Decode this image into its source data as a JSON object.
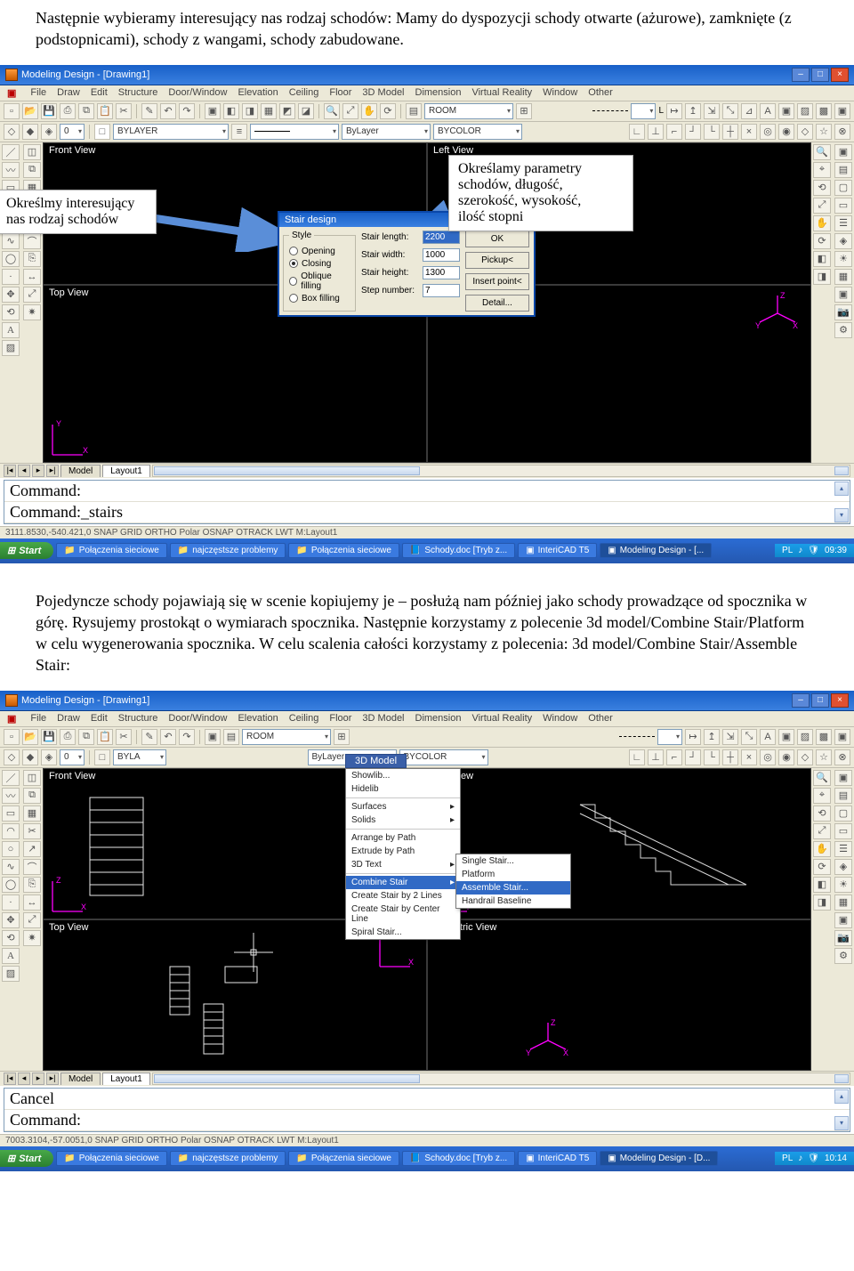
{
  "doc": {
    "intro": "Następnie wybieramy interesujący nas rodzaj schodów: Mamy do dyspozycji schody otwarte (ażurowe), zamknięte (z podstopnicami), schody z wangami, schody zabudowane.",
    "middle": "Pojedyncze schody pojawiają się w scenie kopiujemy je – posłużą nam później jako schody prowadzące od spocznika w górę. Rysujemy prostokąt o wymiarach spocznika. Następnie korzystamy z polecenie 3d model/Combine Stair/Platform w celu wygenerowania spocznika. W celu scalenia całości korzystamy z polecenia: 3d model/Combine Stair/Assemble Stair:"
  },
  "app": {
    "title": "Modeling Design - [Drawing1]",
    "menus": [
      "File",
      "Draw",
      "Edit",
      "Structure",
      "Door/Window",
      "Elevation",
      "Ceiling",
      "Floor",
      "3D Model",
      "Dimension",
      "Virtual Reality",
      "Window",
      "Other"
    ],
    "layer": "BYLAYER",
    "room": "ROOM",
    "bylayer2": "ByLayer",
    "bycolor": "BYCOLOR",
    "tabs": {
      "model": "Model",
      "layout": "Layout1"
    },
    "status1": "3111.8530,-540.421,0        SNAP  GRID  ORTHO  Polar  OSNAP  OTRACK  LWT  M:Layout1",
    "status2": "7003.3104,-57.0051,0        SNAP  GRID  ORTHO  Polar  OSNAP  OTRACK  LWT  M:Layout1",
    "cmd1a": "Command:",
    "cmd1b": "Command:_stairs",
    "cmd2a": "Cancel",
    "cmd2b": "Command:",
    "views": {
      "front": "Front View",
      "left": "Left View",
      "top": "Top View",
      "iso": "Isometric View"
    }
  },
  "callouts": {
    "left_lines": [
      "Określmy interesujący",
      "nas rodzaj schodów"
    ],
    "right_lines": [
      "Określamy parametry",
      "schodów, długość,",
      "szerokość, wysokość,",
      "ilość stopni"
    ]
  },
  "dialog": {
    "title": "Stair design",
    "style_label": "Style",
    "opening": "Opening",
    "closing": "Closing",
    "oblique": "Oblique filling",
    "box": "Box filling",
    "params": {
      "length_label": "Stair length:",
      "length": "2200",
      "width_label": "Stair width:",
      "width": "1000",
      "height_label": "Stair height:",
      "height": "1300",
      "step_label": "Step number:",
      "step": "7"
    },
    "buttons": {
      "ok": "OK",
      "pickup": "Pickup<",
      "insert": "Insert point<",
      "detail": "Detail..."
    }
  },
  "menu3d": {
    "label": "3D Model",
    "items": [
      "Showlib...",
      "Hidelib",
      "",
      "Surfaces",
      "Solids",
      "",
      "Arrange by Path",
      "Extrude by Path",
      "3D Text",
      "",
      "Combine Stair",
      "Create Stair by 2 Lines",
      "Create Stair by Center Line",
      "Spiral Stair..."
    ],
    "sub": [
      "Single Stair...",
      "Platform",
      "Assemble Stair...",
      "Handrail Baseline"
    ]
  },
  "taskbar": {
    "start": "Start",
    "items": [
      "Połączenia sieciowe",
      "najczęstsze problemy",
      "Połączenia sieciowe",
      "Schody.doc [Tryb z...",
      "InteriCAD T5",
      "Modeling Design - [..."
    ],
    "items2": [
      "Połączenia sieciowe",
      "najczęstsze problemy",
      "Połączenia sieciowe",
      "Schody.doc [Tryb z...",
      "InteriCAD T5",
      "Modeling Design - [D..."
    ],
    "lang": "PL",
    "time1": "09:39",
    "time2": "10:14"
  }
}
